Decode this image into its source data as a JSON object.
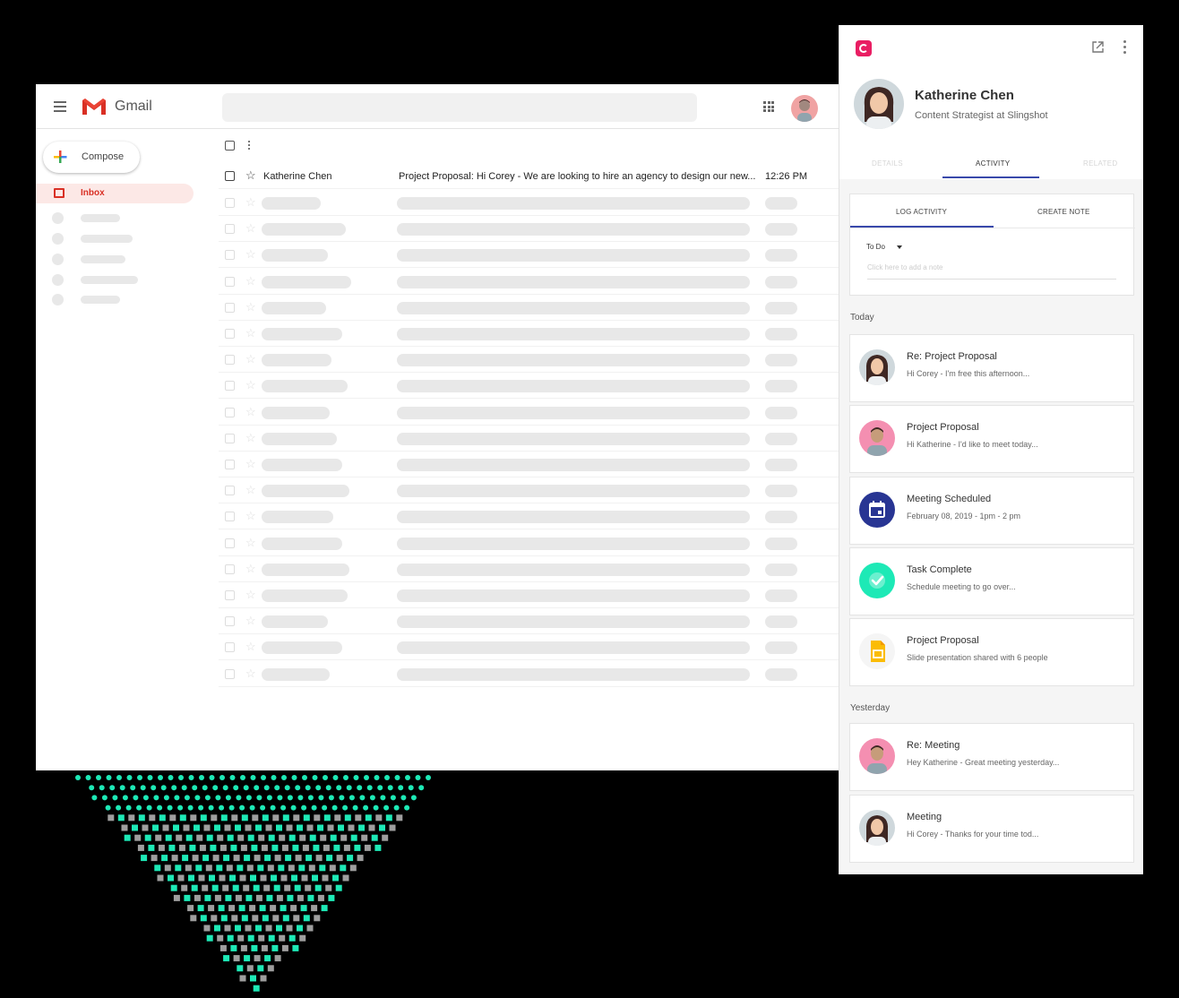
{
  "gmail": {
    "brand": "Gmail",
    "compose_label": "Compose",
    "inbox_label": "Inbox",
    "first_email": {
      "sender": "Katherine Chen",
      "subject": "Project Proposal: Hi Corey - We are looking to hire an agency to design our new...",
      "time": "12:26 PM"
    }
  },
  "panel": {
    "contact_name": "Katherine Chen",
    "contact_role": "Content Strategist  at Slingshot",
    "tabs": [
      "DETAILS",
      "ACTIVITY",
      "RELATED"
    ],
    "log_tabs": [
      "LOG ACTIVITY",
      "CREATE NOTE"
    ],
    "todo_label": "To Do",
    "note_placeholder": "Click here to add a note",
    "sections": {
      "today": "Today",
      "yesterday": "Yesterday"
    },
    "today_items": [
      {
        "title": "Re: Project Proposal",
        "sub": "Hi Corey -  I'm free this afternoon...",
        "icon": "avatar-woman"
      },
      {
        "title": "Project Proposal",
        "sub": "Hi Katherine - I'd like to meet today...",
        "icon": "avatar-man"
      },
      {
        "title": "Meeting Scheduled",
        "sub": "February 08, 2019 - 1pm - 2 pm",
        "icon": "calendar-icon"
      },
      {
        "title": "Task Complete",
        "sub": "Schedule meeting to go over...",
        "icon": "check-circle-icon"
      },
      {
        "title": "Project Proposal",
        "sub": "Slide presentation shared with 6 people",
        "icon": "slides-icon"
      }
    ],
    "yesterday_items": [
      {
        "title": "Re: Meeting",
        "sub": "Hey Katherine - Great meeting yesterday...",
        "icon": "avatar-man"
      },
      {
        "title": "Meeting",
        "sub": "Hi Corey - Thanks for your time tod...",
        "icon": "avatar-woman"
      }
    ]
  },
  "colors": {
    "accent": "#3949ab",
    "brand_pink": "#e91e63",
    "gmail_red": "#d93025",
    "teal_dots": "#1de9b6"
  }
}
